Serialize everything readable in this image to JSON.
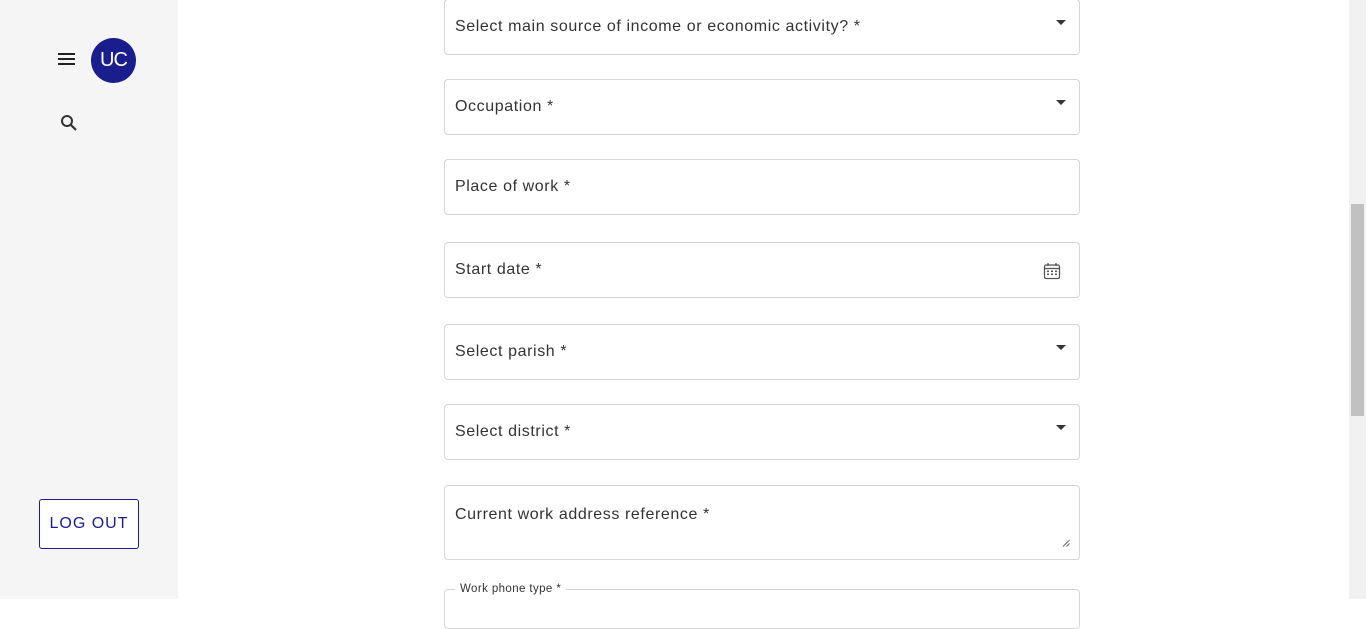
{
  "sidebar": {
    "menu_icon": "hamburger-menu-icon",
    "avatar_initials": "UC",
    "search_icon": "search-icon",
    "logout_label": "LOG OUT"
  },
  "form": {
    "income_source_label": "Select main source of income or economic activity? *",
    "occupation_label": "Occupation *",
    "place_of_work_label": "Place of work *",
    "start_date_label": "Start date *",
    "parish_label": "Select parish *",
    "district_label": "Select district *",
    "work_address_label": "Current work address reference *",
    "work_phone_type_label": "Work phone type *"
  },
  "colors": {
    "brand": "#1a1e8c",
    "sidebar_bg": "#f5f5f5",
    "border": "#d6d6d6"
  }
}
